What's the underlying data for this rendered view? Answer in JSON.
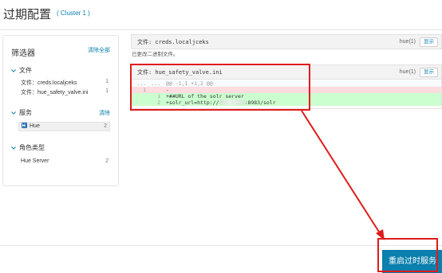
{
  "page": {
    "title": "过期配置",
    "cluster_link": "( Cluster 1 )"
  },
  "filter_panel": {
    "title": "筛选器",
    "clear_all": "清除全部",
    "sections": [
      {
        "label": "文件",
        "items": [
          {
            "label": "文件：creds.localjceks",
            "count": "1"
          },
          {
            "label": "文件：hue_safety_valve.ini",
            "count": "1"
          }
        ]
      },
      {
        "label": "服务",
        "clear": "清除",
        "items": [
          {
            "label": "Hue",
            "count": "2"
          }
        ]
      },
      {
        "label": "角色类型",
        "items": [
          {
            "label": "Hue Server",
            "count": "2"
          }
        ]
      }
    ]
  },
  "files": [
    {
      "name": "文件: creds.localjceks",
      "role": "hue(1)",
      "button": "显示",
      "note": "已更改二进制文件。"
    },
    {
      "name": "文件: hue_safety_valve.ini",
      "role": "hue(1)",
      "button": "显示",
      "diff": {
        "hunk_ln1": "...",
        "hunk_ln2": "...",
        "hunk": "@@ -1,1 +1,2 @@",
        "del_ln1": "1",
        "del_code": "-",
        "add1_ln2": "1",
        "add1_code": "+##URL of the solr server",
        "add2_ln2": "2",
        "add2_prefix": "+solr_url=http://",
        "add2_suffix": ":8983/solr"
      }
    }
  ],
  "footer": {
    "restart_button": "重启过时服务"
  },
  "colors": {
    "accent": "#0b7fad",
    "annotation": "#e01b1b",
    "diff_added": "#ccffd0",
    "diff_removed": "#ffdce0"
  },
  "icons": {
    "chevron": "chevron-down-icon",
    "hue": "hue-service-icon"
  }
}
